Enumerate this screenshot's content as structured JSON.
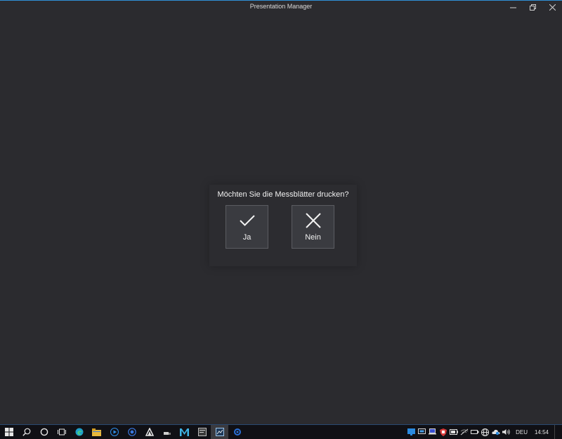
{
  "window": {
    "title": "Presentation Manager"
  },
  "dialog": {
    "question": "Möchten Sie die Messblätter drucken?",
    "yes_label": "Ja",
    "no_label": "Nein"
  },
  "taskbar": {
    "language": "DEU",
    "time": "14:54"
  }
}
